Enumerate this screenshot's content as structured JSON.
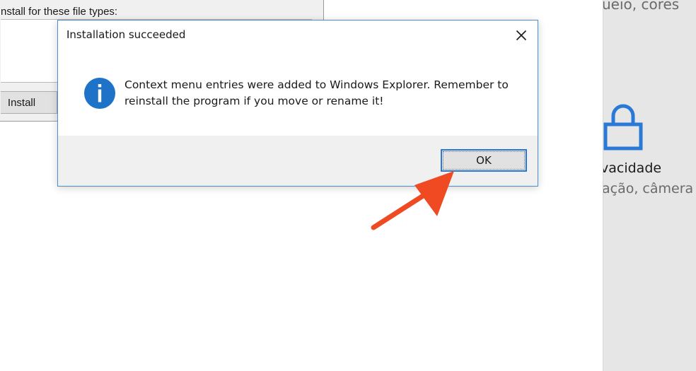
{
  "background_window": {
    "label": "nstall for these file types:",
    "install_button_label": "Install"
  },
  "settings_panel": {
    "top_text": "ueio, cores",
    "privacy_heading": "vacidade",
    "privacy_sub": "ação, câmera",
    "icon": "lock-icon"
  },
  "dialog": {
    "title": "Installation succeeded",
    "message": "Context menu entries were added to Windows Explorer. Remember to reinstall the program if you move or rename it!",
    "ok_label": "OK",
    "icon": "info-icon",
    "close_icon": "close-icon"
  },
  "colors": {
    "accent_blue": "#2b79d6",
    "info_icon_blue": "#1e73c9",
    "annotation_red": "#f04a23"
  }
}
